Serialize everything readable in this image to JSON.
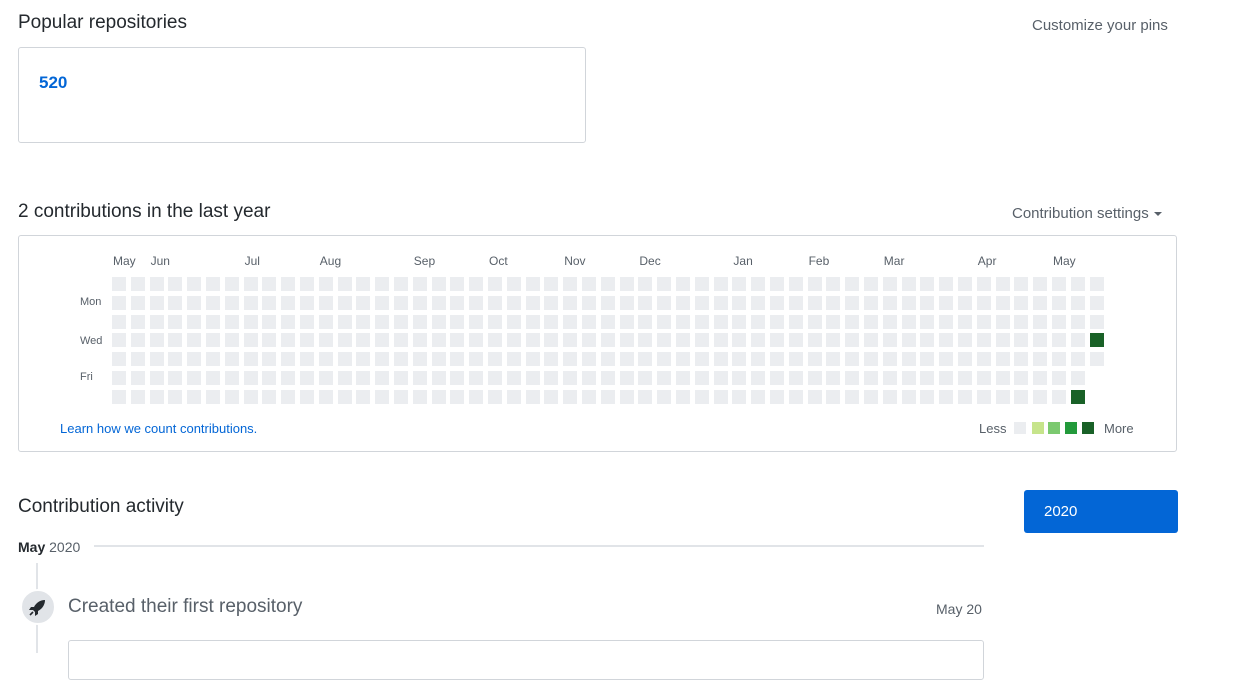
{
  "pins": {
    "title": "Popular repositories",
    "customize_label": "Customize your pins",
    "repo_name": "520"
  },
  "contributions": {
    "title": "2 contributions in the last year",
    "settings_label": "Contribution settings",
    "months": [
      "May",
      "Jun",
      "Jul",
      "Aug",
      "Sep",
      "Oct",
      "Nov",
      "Dec",
      "Jan",
      "Feb",
      "Mar",
      "Apr",
      "May"
    ],
    "day_labels": [
      "Mon",
      "Wed",
      "Fri"
    ],
    "learn_link": "Learn how we count contributions.",
    "legend_less": "Less",
    "legend_more": "More",
    "colors": {
      "empty": "#ebedf0",
      "level1": "#c6e48b",
      "level2": "#7bc96f",
      "level3": "#239a3b",
      "level4": "#196127"
    },
    "weeks": 53,
    "last_week_days": 5,
    "active_cells": [
      {
        "week": 51,
        "day": 6,
        "level": 4
      },
      {
        "week": 52,
        "day": 3,
        "level": 4
      }
    ]
  },
  "activity": {
    "title": "Contribution activity",
    "month": "May",
    "year_text": "2020",
    "year_button": "2020",
    "event_title": "Created their first repository",
    "event_date": "May 20",
    "event_icon": "rocket-icon"
  }
}
